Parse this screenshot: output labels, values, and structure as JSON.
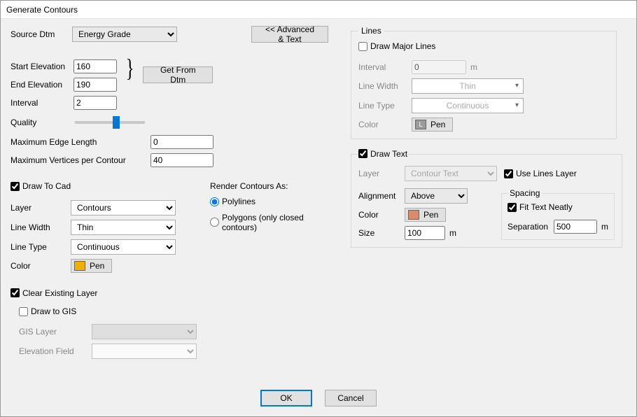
{
  "title": "Generate Contours",
  "left": {
    "source_dtm_label": "Source Dtm",
    "source_dtm_value": "Energy Grade",
    "advanced_btn": "<< Advanced & Text",
    "start_elev_label": "Start Elevation",
    "start_elev_value": "160",
    "end_elev_label": "End Elevation",
    "end_elev_value": "190",
    "get_from_dtm_btn": "Get From Dtm",
    "interval_label": "Interval",
    "interval_value": "2",
    "quality_label": "Quality",
    "max_edge_label": "Maximum Edge Length",
    "max_edge_value": "0",
    "max_verts_label": "Maximum Vertices per Contour",
    "max_verts_value": "40",
    "draw_to_cad_label": "Draw To Cad",
    "layer_label": "Layer",
    "layer_value": "Contours",
    "linewidth_label": "Line Width",
    "linewidth_value": "Thin",
    "linetype_label": "Line Type",
    "linetype_value": "Continuous",
    "color_label": "Color",
    "pen_btn": "Pen",
    "pen_swatch_color": "#f0b000",
    "render_label": "Render Contours As:",
    "render_polylines": "Polylines",
    "render_polygons": "Polygons (only closed contours)",
    "clear_layer_label": "Clear Existing Layer",
    "draw_to_gis_label": "Draw to GIS",
    "gis_layer_label": "GIS Layer",
    "elev_field_label": "Elevation Field"
  },
  "lines": {
    "group": "Lines",
    "draw_major_label": "Draw Major Lines",
    "interval_label": "Interval",
    "interval_value": "0",
    "interval_unit": "m",
    "linewidth_label": "Line Width",
    "linewidth_value": "Thin",
    "linetype_label": "Line Type",
    "linetype_value": "Continuous",
    "color_label": "Color",
    "pen_btn": "Pen",
    "pen_swatch_letter": "L"
  },
  "text": {
    "draw_text_label": "Draw Text",
    "layer_label": "Layer",
    "layer_value": "Contour Text",
    "use_lines_layer_label": "Use Lines Layer",
    "alignment_label": "Alignment",
    "alignment_value": "Above",
    "color_label": "Color",
    "pen_btn": "Pen",
    "pen_swatch_color": "#d98b6b",
    "size_label": "Size",
    "size_value": "100",
    "size_unit": "m",
    "spacing_group": "Spacing",
    "fit_neatly_label": "Fit Text Neatly",
    "separation_label": "Separation",
    "separation_value": "500",
    "separation_unit": "m"
  },
  "buttons": {
    "ok": "OK",
    "cancel": "Cancel"
  }
}
